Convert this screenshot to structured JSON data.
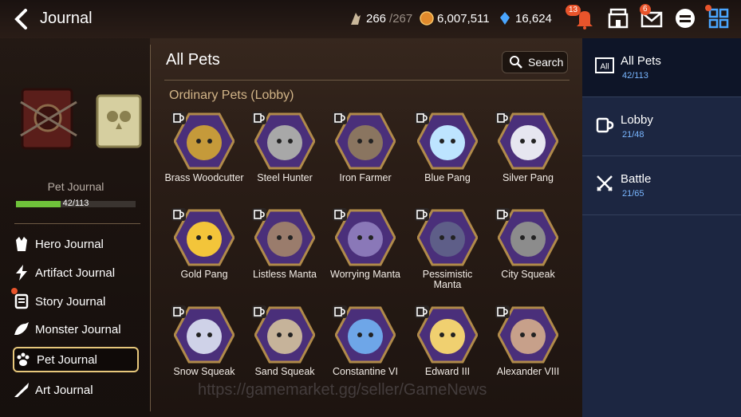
{
  "header": {
    "title": "Journal",
    "stamina": "266",
    "stamina_max": "/267",
    "gold": "6,007,511",
    "crystals": "16,624",
    "notif_badge": "13",
    "mail_badge": "6"
  },
  "left_panel": {
    "journal_label": "Pet Journal",
    "progress_text": "42/113",
    "progress_fraction": 0.372,
    "menu": [
      {
        "label": "Hero Journal",
        "icon": "hero-icon"
      },
      {
        "label": "Artifact Journal",
        "icon": "artifact-icon"
      },
      {
        "label": "Story Journal",
        "icon": "story-icon"
      },
      {
        "label": "Monster Journal",
        "icon": "monster-icon"
      },
      {
        "label": "Pet Journal",
        "icon": "paw-icon"
      },
      {
        "label": "Art Journal",
        "icon": "art-icon"
      }
    ]
  },
  "main": {
    "title": "All Pets",
    "search_label": "Search",
    "section_title": "Ordinary Pets (Lobby)",
    "pets": [
      {
        "name": "Brass Woodcutter",
        "color": "#c59a3a"
      },
      {
        "name": "Steel Hunter",
        "color": "#a8a8a8"
      },
      {
        "name": "Iron Farmer",
        "color": "#8a7560"
      },
      {
        "name": "Blue Pang",
        "color": "#bde4ff"
      },
      {
        "name": "Silver Pang",
        "color": "#e6e6f0"
      },
      {
        "name": "Gold Pang",
        "color": "#f3c53a"
      },
      {
        "name": "Listless Manta",
        "color": "#9a7c6c"
      },
      {
        "name": "Worrying Manta",
        "color": "#8a78b8"
      },
      {
        "name": "Pessimistic Manta",
        "color": "#5e5e88"
      },
      {
        "name": "City Squeak",
        "color": "#8c8c8c"
      },
      {
        "name": "Snow Squeak",
        "color": "#cfd2e8"
      },
      {
        "name": "Sand Squeak",
        "color": "#c6b39a"
      },
      {
        "name": "Constantine VI",
        "color": "#6ea6e8"
      },
      {
        "name": "Edward III",
        "color": "#f0d070"
      },
      {
        "name": "Alexander VIII",
        "color": "#c7a08a"
      }
    ]
  },
  "right_panel": {
    "items": [
      {
        "label": "All Pets",
        "count": "42/113",
        "icon": "all-icon"
      },
      {
        "label": "Lobby",
        "count": "21/48",
        "icon": "mug-icon"
      },
      {
        "label": "Battle",
        "count": "21/65",
        "icon": "swords-icon"
      }
    ]
  },
  "watermark": "https://gamemarket.gg/seller/GameNews"
}
